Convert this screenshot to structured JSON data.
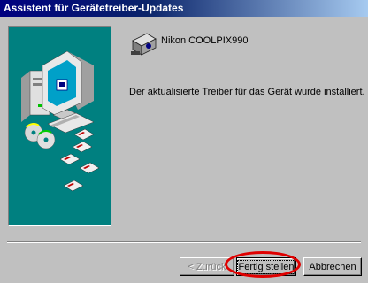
{
  "window": {
    "title": "Assistent für Gerätetreiber-Updates"
  },
  "device": {
    "icon": "camera-device-icon",
    "name": "Nikon COOLPIX990"
  },
  "message": "Der aktualisierte Treiber für das Gerät wurde installiert.",
  "buttons": {
    "back_label": "< Zurück",
    "back_enabled": false,
    "finish_label": "Fertig stellen",
    "cancel_label": "Abbrechen"
  },
  "illustration": {
    "icon": "computer-with-disks-illustration"
  },
  "colors": {
    "title_bar": "#000080",
    "panel": "#008080",
    "highlight_ring": "#e00000",
    "face": "#c0c0c0"
  }
}
